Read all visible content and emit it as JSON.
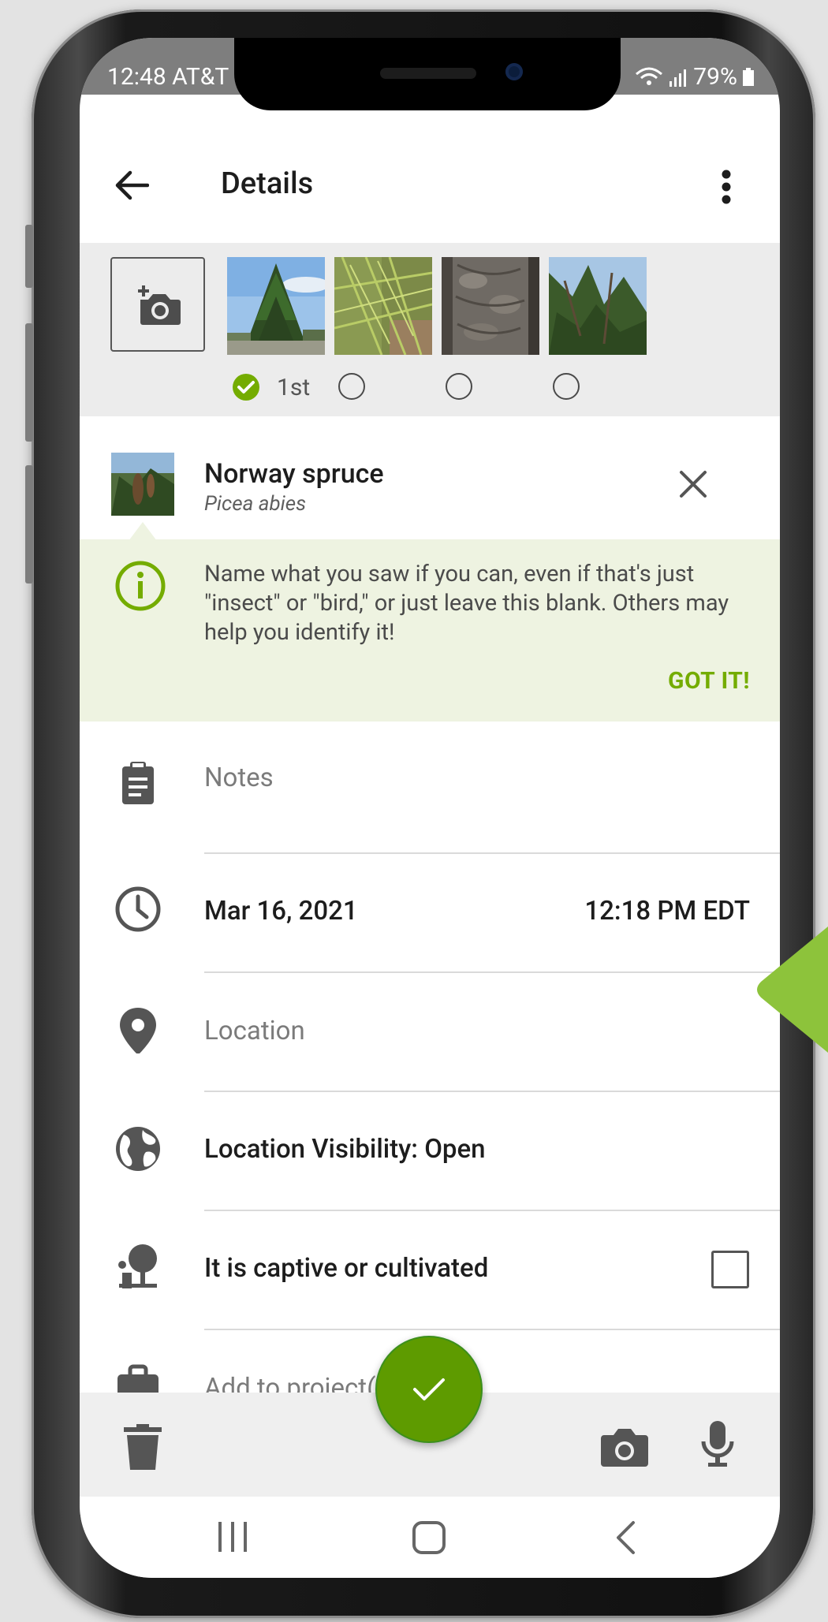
{
  "status_bar": {
    "time": "12:48 AT&T",
    "battery": "79%"
  },
  "appbar": {
    "title": "Details"
  },
  "photos": {
    "thumbs": [
      {
        "name": "tree-photo"
      },
      {
        "name": "needles-photo"
      },
      {
        "name": "bark-photo"
      },
      {
        "name": "canopy-photo"
      }
    ],
    "first_label": "1st"
  },
  "species": {
    "common_name": "Norway spruce",
    "scientific_name": "Picea abies"
  },
  "tip": {
    "text": "Name what you saw if you can, even if that's just \"insect\" or \"bird,\" or just leave this blank. Others may help you identify it!",
    "button": "GOT IT!"
  },
  "form": {
    "notes_placeholder": "Notes",
    "date": "Mar 16, 2021",
    "time": "12:18 PM EDT",
    "location_placeholder": "Location",
    "visibility": "Location Visibility: Open",
    "captive_label": "It is captive or cultivated",
    "project_placeholder": "Add to project(s)"
  },
  "colors": {
    "accent": "#74ac00",
    "fab": "#5e9b00",
    "callout": "#8dc33b",
    "tip_bg": "#eef3e1"
  },
  "icons": [
    "back-arrow-icon",
    "more-vert-icon",
    "add-photo-icon",
    "check-circle-icon",
    "close-icon",
    "info-icon",
    "clipboard-icon",
    "clock-icon",
    "location-pin-icon",
    "globe-icon",
    "captive-tree-icon",
    "briefcase-icon",
    "trash-icon",
    "camera-icon",
    "microphone-icon",
    "check-icon",
    "recents-icon",
    "home-icon",
    "back-nav-icon"
  ]
}
